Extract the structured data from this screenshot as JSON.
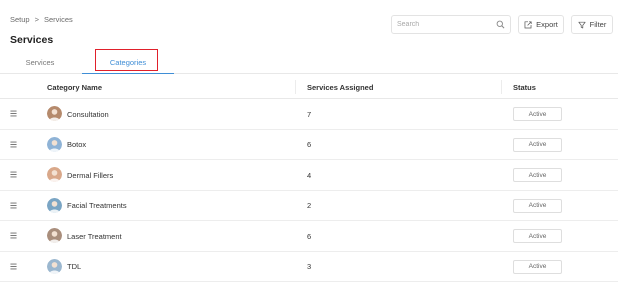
{
  "breadcrumb": {
    "root": "Setup",
    "separator": ">",
    "current": "Services"
  },
  "page_title": "Services",
  "search": {
    "placeholder": "Search",
    "value": ""
  },
  "toolbar": {
    "export_label": "Export",
    "filter_label": "Filter"
  },
  "tabs": [
    {
      "label": "Services",
      "active": false
    },
    {
      "label": "Categories",
      "active": true
    }
  ],
  "accent_color": "#3f8ed6",
  "highlight_color": "#e0202b",
  "table": {
    "columns": [
      "Category Name",
      "Services Assigned",
      "Status"
    ],
    "rows": [
      {
        "name": "Consultation",
        "assigned": "7",
        "status": "Active",
        "avatar_color": "#b58a6c"
      },
      {
        "name": "Botox",
        "assigned": "6",
        "status": "Active",
        "avatar_color": "#8fb3d6"
      },
      {
        "name": "Dermal Fillers",
        "assigned": "4",
        "status": "Active",
        "avatar_color": "#d9a88a"
      },
      {
        "name": "Facial Treatments",
        "assigned": "2",
        "status": "Active",
        "avatar_color": "#7aa5c4"
      },
      {
        "name": "Laser Treatment",
        "assigned": "6",
        "status": "Active",
        "avatar_color": "#a98e7c"
      },
      {
        "name": "TDL",
        "assigned": "3",
        "status": "Active",
        "avatar_color": "#9bb7cf"
      }
    ]
  }
}
